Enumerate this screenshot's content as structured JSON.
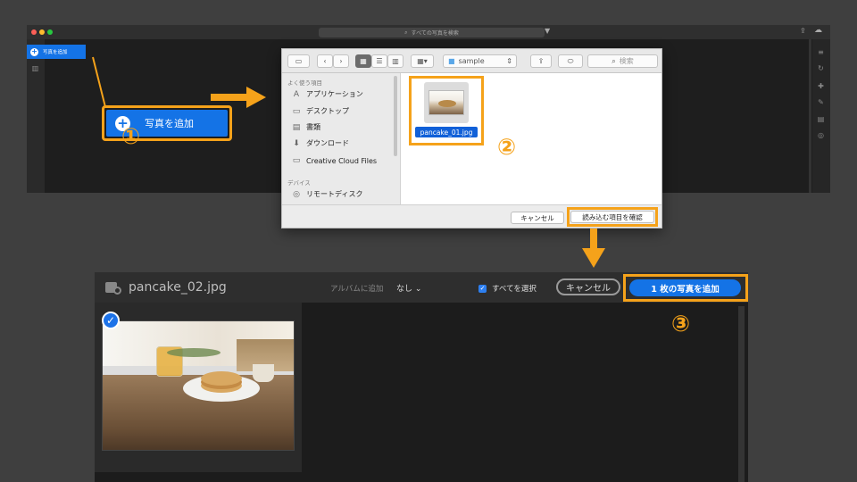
{
  "app": {
    "search_placeholder": "すべての写真を検索",
    "small_add_label": "写真を追加",
    "big_add_label": "写真を追加"
  },
  "steps": {
    "step1": "①",
    "step2": "②",
    "step3": "③"
  },
  "dialog": {
    "location": "sample",
    "search_placeholder": "検索",
    "sidebar": {
      "favorites_heading": "よく使う項目",
      "favorites": [
        {
          "label": "アプリケーション",
          "icon": "applications-icon"
        },
        {
          "label": "デスクトップ",
          "icon": "desktop-folder-icon"
        },
        {
          "label": "書類",
          "icon": "documents-icon"
        },
        {
          "label": "ダウンロード",
          "icon": "downloads-icon"
        },
        {
          "label": "Creative Cloud Files",
          "icon": "folder-icon"
        }
      ],
      "devices_heading": "デバイス",
      "devices": [
        {
          "label": "リモートディスク",
          "icon": "remote-disc-icon"
        }
      ]
    },
    "file": {
      "name": "pancake_01.jpg"
    },
    "cancel_label": "キャンセル",
    "confirm_label": "読み込む項目を確認"
  },
  "import_panel": {
    "title": "pancake_02.jpg",
    "album_label": "アルバムに追加",
    "album_value": "なし",
    "select_all_label": "すべてを選択",
    "select_all_checked": true,
    "cancel_label": "キャンセル",
    "add_label": "1 枚の写真を追加",
    "photo_selected": true
  },
  "colors": {
    "accent_blue": "#1473e6",
    "highlight_orange": "#f5a21a"
  }
}
